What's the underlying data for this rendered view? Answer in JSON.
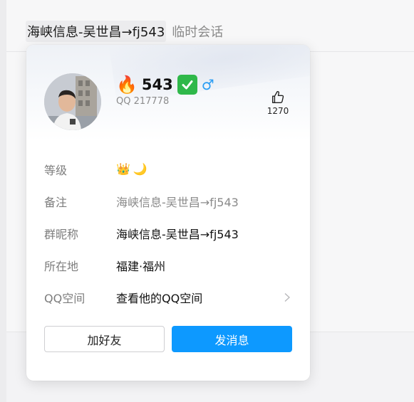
{
  "chat": {
    "title": "海峡信息-吴世昌→fj543",
    "subtitle": "临时会话"
  },
  "profile": {
    "fire_emoji": "🔥",
    "nickname": "543",
    "verified_icon": "check-mark-icon",
    "gender_symbol": "♂",
    "qq_number": "QQ 217778",
    "likes": "1270",
    "rows": [
      {
        "label": "等级",
        "value": "👑🌙"
      },
      {
        "label": "备注",
        "value": "海峡信息-吴世昌→fj543"
      },
      {
        "label": "群昵称",
        "value": "海峡信息-吴世昌→fj543"
      },
      {
        "label": "所在地",
        "value": "福建·福州"
      },
      {
        "label": "QQ空间",
        "value": "查看他的QQ空间"
      }
    ],
    "level_icons": [
      "👑",
      "🌙"
    ]
  },
  "buttons": {
    "add_friend": "加好友",
    "send_message": "发消息"
  },
  "colors": {
    "accent": "#0d99ff",
    "verified": "#2fb84a",
    "gender": "#2a9df4"
  }
}
